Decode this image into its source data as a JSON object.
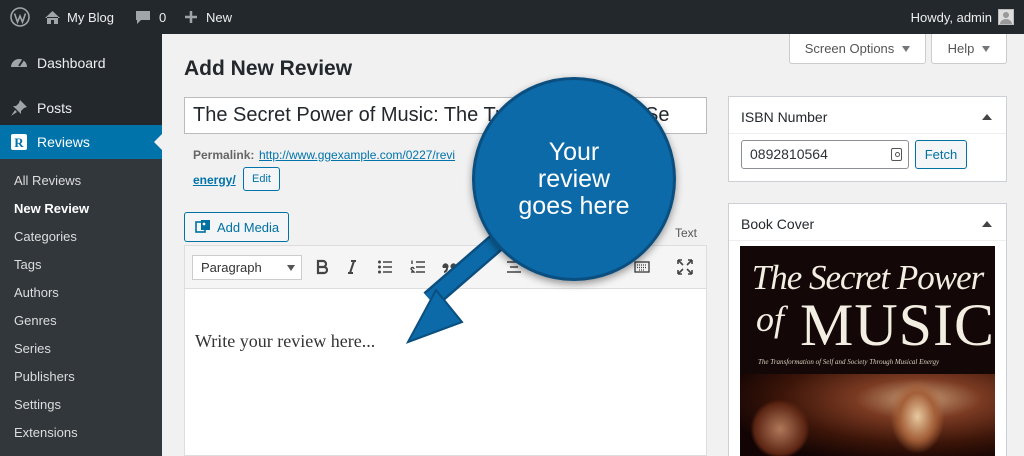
{
  "adminbar": {
    "site_name": "My Blog",
    "comments_count": "0",
    "new_label": "New",
    "howdy": "Howdy, admin"
  },
  "sidebar": {
    "dashboard": "Dashboard",
    "posts": "Posts",
    "reviews": "Reviews",
    "submenu": [
      "All Reviews",
      "New Review",
      "Categories",
      "Tags",
      "Authors",
      "Genres",
      "Series",
      "Publishers",
      "Settings",
      "Extensions"
    ]
  },
  "screen_options": "Screen Options",
  "help": "Help",
  "page_title": "Add New Review",
  "editor": {
    "title_value": "The Secret Power of Music: The Transformation of Se",
    "permalink_label": "Permalink:",
    "permalink_url": "http://www.ggexample.com/0227/revi",
    "permalink_url_end": "energy/",
    "edit_label": "Edit",
    "add_media": "Add Media",
    "text_tab": "Text",
    "format": "Paragraph",
    "placeholder": "Write your review here..."
  },
  "isbn_box": {
    "title": "ISBN Number",
    "value": "0892810564",
    "fetch": "Fetch"
  },
  "cover_box": {
    "title": "Book Cover",
    "cover_title_line1": "The Secret Power",
    "cover_title_of": "of",
    "cover_title_music": "MUSIC",
    "cover_subtitle": "The Transformation of Self and Society Through Musical Energy"
  },
  "callout": {
    "text": "Your review goes here"
  },
  "colors": {
    "adminbar": "#23282d",
    "accent": "#0073aa",
    "callout": "#0c6aa8"
  }
}
